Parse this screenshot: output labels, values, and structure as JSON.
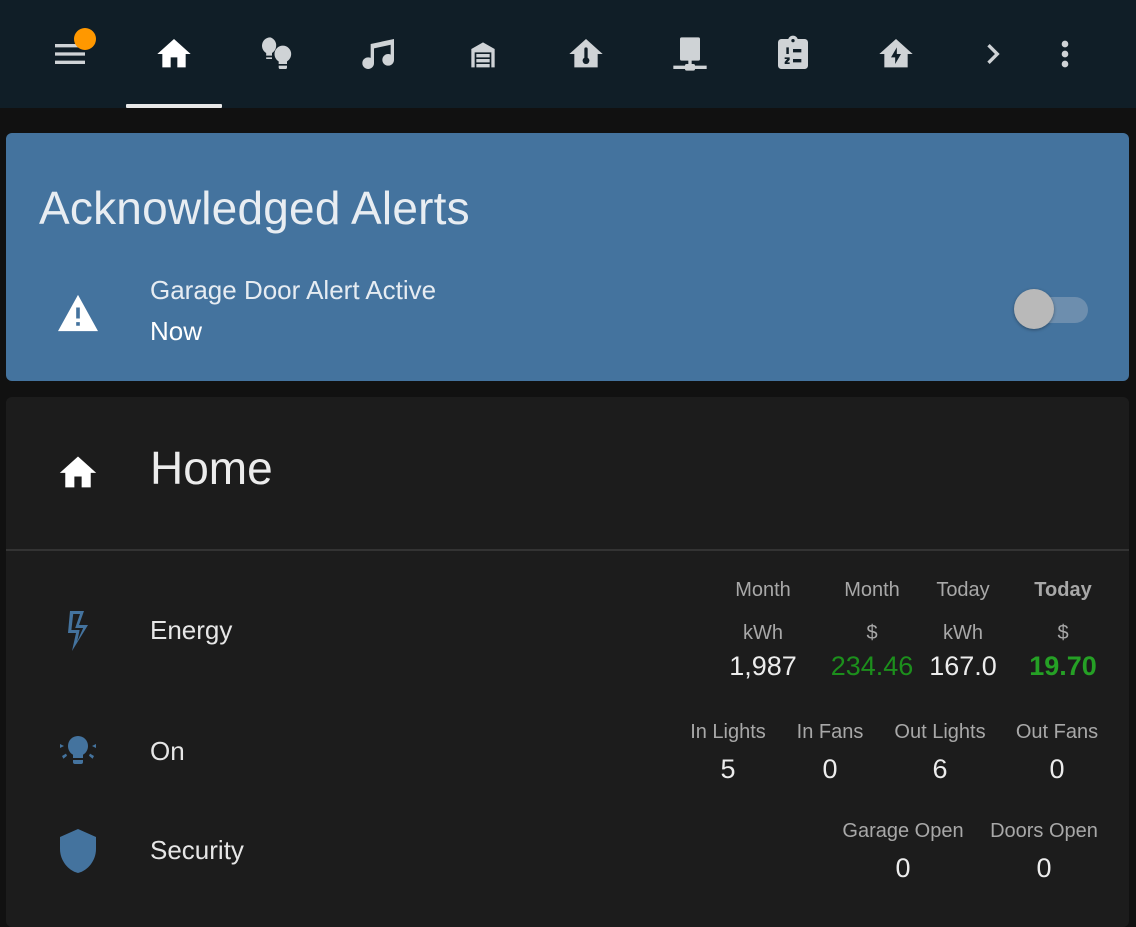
{
  "topbar": {
    "tabs": [
      {
        "icon": "menu-icon",
        "has_badge": true
      },
      {
        "icon": "home-icon",
        "active": true
      },
      {
        "icon": "lightbulb-group-icon"
      },
      {
        "icon": "music-icon"
      },
      {
        "icon": "garage-icon"
      },
      {
        "icon": "home-thermometer-icon"
      },
      {
        "icon": "server-network-icon"
      },
      {
        "icon": "clipboard-list-icon"
      },
      {
        "icon": "home-lightning-icon"
      },
      {
        "icon": "chevron-right-icon"
      },
      {
        "icon": "dots-vertical-icon"
      }
    ],
    "badge_color": "#ff9800"
  },
  "alerts": {
    "title": "Acknowledged Alerts",
    "card_color": "#44739e",
    "item": {
      "icon": "alert-icon",
      "name": "Garage Door Alert Active",
      "time": "Now",
      "toggle_on": false
    }
  },
  "home": {
    "title": "Home",
    "icon": "home-icon",
    "energy": {
      "label": "Energy",
      "icon": "lightning-bolt-icon",
      "columns": [
        {
          "head": "Month",
          "unit": "kWh",
          "value": "1,987"
        },
        {
          "head": "Month",
          "unit": "$",
          "value": "234.46"
        },
        {
          "head": "Today",
          "unit": "kWh",
          "value": "167.0"
        },
        {
          "head": "Today",
          "unit": "$",
          "value": "19.70"
        }
      ]
    },
    "on": {
      "label": "On",
      "icon": "lightbulb-group-icon",
      "columns": [
        {
          "head": "In Lights",
          "value": "5"
        },
        {
          "head": "In Fans",
          "value": "0"
        },
        {
          "head": "Out Lights",
          "value": "6"
        },
        {
          "head": "Out Fans",
          "value": "0"
        }
      ]
    },
    "security": {
      "label": "Security",
      "icon": "shield-icon",
      "columns": [
        {
          "head": "Garage Open",
          "value": "0"
        },
        {
          "head": "Doors Open",
          "value": "0"
        }
      ]
    },
    "accent_color": "#44739e",
    "money_color": "#1c8f1c"
  }
}
